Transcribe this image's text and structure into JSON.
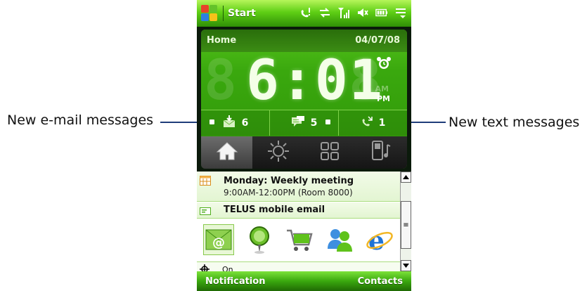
{
  "callouts": {
    "left": "New e-mail messages",
    "right": "New text messages"
  },
  "titlebar": {
    "start_label": "Start",
    "status_icons": [
      "phone-missed-icon",
      "sync-icon",
      "signal-icon",
      "speaker-mute-icon",
      "battery-icon",
      "menu-icon"
    ]
  },
  "home": {
    "label": "Home",
    "date": "04/07/08",
    "clock": {
      "time": "6:01",
      "am_label": "AM",
      "pm_label": "PM"
    },
    "notifications": {
      "email_count": "6",
      "text_count": "5",
      "missed_calls_count": "1"
    },
    "tabs": [
      "home-icon",
      "weather-icon",
      "apps-grid-icon",
      "music-icon"
    ]
  },
  "list": {
    "appointment_title": "Monday: Weekly meeting",
    "appointment_time": "9:00AM-12:00PM (Room 8000)",
    "email_item": "TELUS mobile email",
    "apps": [
      "email-app-icon",
      "gps-app-icon",
      "shopping-cart-app-icon",
      "messenger-app-icon",
      "internet-explorer-app-icon"
    ],
    "partial_item": "On"
  },
  "softkeys": {
    "left": "Notification",
    "right": "Contacts"
  },
  "colors": {
    "accent_green": "#3aa80e",
    "callout_line": "#1f3d7a"
  }
}
